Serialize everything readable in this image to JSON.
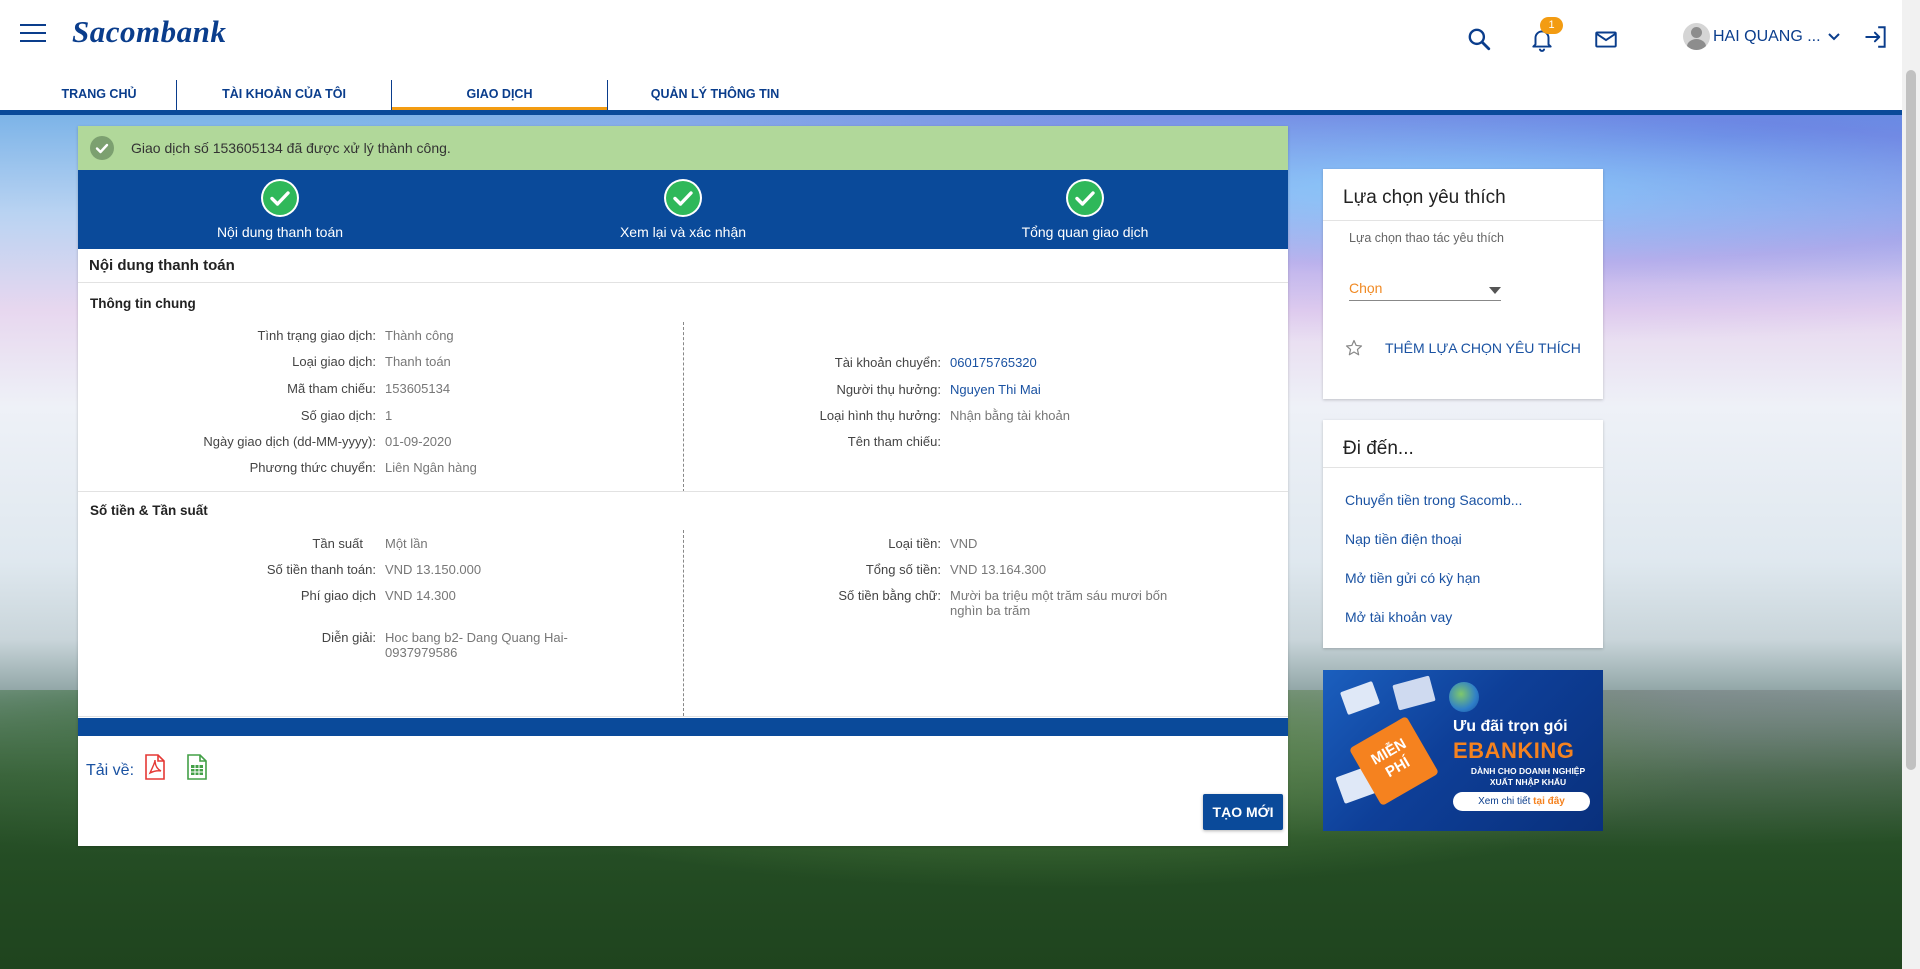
{
  "header": {
    "logo": "Sacombank",
    "notification_count": "1",
    "username": "HAI QUANG ...",
    "nav": [
      {
        "label": "TRANG CHỦ"
      },
      {
        "label": "TÀI KHOẢN CỦA TÔI"
      },
      {
        "label": "GIAO DỊCH",
        "active": true
      },
      {
        "label": "QUẢN LÝ THÔNG TIN"
      }
    ]
  },
  "alert": {
    "message": "Giao dịch số 153605134 đã được xử lý thành công."
  },
  "steps": [
    {
      "label": "Nội dung thanh toán"
    },
    {
      "label": "Xem lại và xác nhận"
    },
    {
      "label": "Tổng quan giao dịch"
    }
  ],
  "content": {
    "title": "Nội dung thanh toán",
    "general": {
      "title": "Thông tin chung",
      "left": [
        {
          "label": "Tình trạng giao dịch:",
          "value": "Thành công"
        },
        {
          "label": "Loại giao dịch:",
          "value": "Thanh toán"
        },
        {
          "label": "Mã tham chiếu:",
          "value": "153605134"
        },
        {
          "label": "Số giao dịch:",
          "value": "1"
        },
        {
          "label": "Ngày giao dịch (dd-MM-yyyy):",
          "value": "01-09-2020"
        },
        {
          "label": "Phương thức chuyển:",
          "value": "Liên Ngân hàng"
        }
      ],
      "right": [
        {
          "label": "Tài khoản chuyển:",
          "value": "060175765320"
        },
        {
          "label": "Người thụ hưởng:",
          "value": "Nguyen Thi Mai"
        },
        {
          "label": "Loại hình thụ hưởng:",
          "value": "Nhận bằng tài khoản"
        },
        {
          "label": "Tên tham chiếu:",
          "value": ""
        }
      ]
    },
    "amount": {
      "title": "Số tiền & Tần suất",
      "left": [
        {
          "label": "Tần suất",
          "value": "Một lần"
        },
        {
          "label": "Số tiền thanh toán:",
          "value": "VND 13.150.000"
        },
        {
          "label": "Phí giao dịch",
          "value": "VND 14.300"
        },
        {
          "label": "Diễn giải:",
          "value": "Hoc bang b2- Dang Quang Hai-0937979586"
        }
      ],
      "right": [
        {
          "label": "Loại tiền:",
          "value": "VND"
        },
        {
          "label": "Tổng số tiền:",
          "value": "VND 13.164.300"
        },
        {
          "label": "Số tiền bằng chữ:",
          "value": "Mười ba triệu một trăm sáu mươi bốn nghìn ba trăm"
        }
      ]
    },
    "download_label": "Tải về:",
    "new_button": "TẠO MỚI"
  },
  "favorites": {
    "title": "Lựa chọn yêu thích",
    "hint": "Lựa chọn thao tác yêu thích",
    "select_value": "Chọn",
    "add_label": "THÊM LỰA CHỌN YÊU THÍCH"
  },
  "goto": {
    "title": "Đi đến...",
    "links": [
      "Chuyển tiền trong Sacomb...",
      "Nạp tiền điện thoại",
      "Mở tiền gửi có kỳ hạn",
      "Mở tài khoản vay"
    ]
  },
  "banner": {
    "free": "MIỄN PHÍ",
    "title": "Ưu đãi trọn gói",
    "brand": "EBANKING",
    "subtitle": "DÀNH CHO DOANH NGHIỆP XUẤT NHẬP KHẨU",
    "cta_prefix": "Xem chi tiết",
    "cta_link": "tại đây"
  },
  "colors": {
    "brand_blue": "#0a4a9a",
    "accent_orange": "#f39c12",
    "success_green": "#b1d89a"
  }
}
